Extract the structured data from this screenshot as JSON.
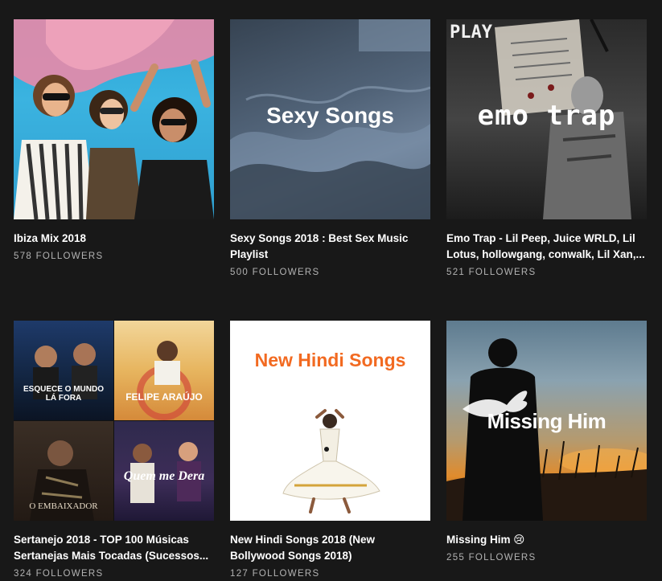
{
  "playlists": [
    {
      "title": "Ibiza Mix 2018",
      "followers": "578 FOLLOWERS",
      "cover_text": ""
    },
    {
      "title": "Sexy Songs 2018 : Best Sex Music Playlist",
      "followers": "500 FOLLOWERS",
      "cover_text": "Sexy Songs"
    },
    {
      "title": "Emo Trap - Lil Peep, Juice WRLD, Lil Lotus, hollowgang, conwalk, Lil Xan,...",
      "followers": "521 FOLLOWERS",
      "cover_text": "emo trap",
      "cover_badge": "PLAY"
    },
    {
      "title": "Sertanejo 2018 - TOP 100 Músicas Sertanejas Mais Tocadas (Sucessos...",
      "followers": "324 FOLLOWERS",
      "cover_texts": [
        "ESQUECE O MUNDO LÁ FORA",
        "FELIPE ARAÚJO",
        "O EMBAIXADOR",
        "Quem me Dera"
      ]
    },
    {
      "title": "New Hindi Songs 2018 (New Bollywood Songs 2018)",
      "followers": "127 FOLLOWERS",
      "cover_text": "New Hindi Songs"
    },
    {
      "title": "Missing Him 😢",
      "followers": "255 FOLLOWERS",
      "cover_text": "Missing Him"
    }
  ],
  "colors": {
    "background": "#181818",
    "muted_text": "#b3b3b3",
    "hindi_orange": "#f26a21"
  }
}
